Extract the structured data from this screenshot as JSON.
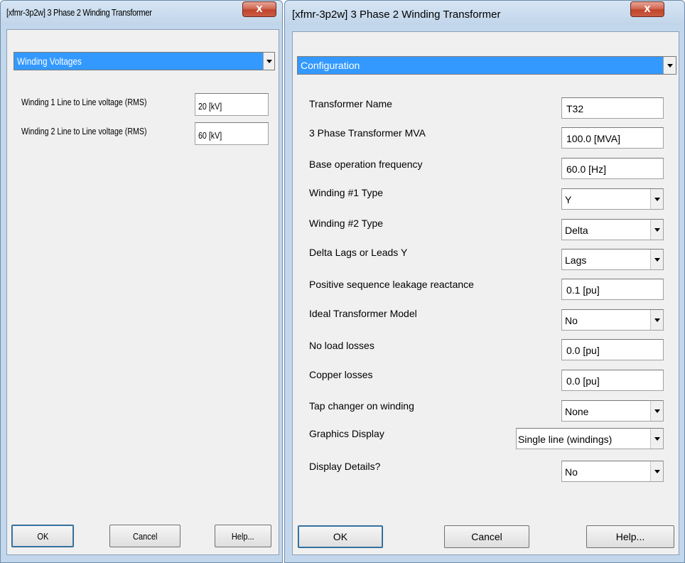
{
  "left_dialog": {
    "title": "[xfmr-3p2w] 3 Phase 2 Winding Transformer",
    "close_label": "X",
    "page_selector": "Winding Voltages",
    "params": [
      {
        "label": "Winding 1 Line to Line voltage (RMS)",
        "value": "20 [kV]"
      },
      {
        "label": "Winding 2 Line to Line voltage (RMS)",
        "value": "60 [kV]"
      }
    ],
    "buttons": {
      "ok": "OK",
      "cancel": "Cancel",
      "help": "Help..."
    }
  },
  "right_dialog": {
    "title": "[xfmr-3p2w] 3 Phase 2 Winding Transformer",
    "close_label": "X",
    "page_selector": "Configuration",
    "params": [
      {
        "label": "Transformer Name",
        "value": "T32",
        "kind": "text"
      },
      {
        "label": "3 Phase Transformer MVA",
        "value": "100.0 [MVA]",
        "kind": "text"
      },
      {
        "label": "Base operation frequency",
        "value": "60.0 [Hz]",
        "kind": "text"
      },
      {
        "label": "Winding #1 Type",
        "value": "Y",
        "kind": "combo"
      },
      {
        "label": "Winding #2 Type",
        "value": "Delta",
        "kind": "combo"
      },
      {
        "label": "Delta Lags or Leads Y",
        "value": "Lags",
        "kind": "combo"
      },
      {
        "label": "Positive sequence leakage reactance",
        "value": "0.1 [pu]",
        "kind": "text"
      },
      {
        "label": "Ideal Transformer Model",
        "value": "No",
        "kind": "combo"
      },
      {
        "label": "No load losses",
        "value": "0.0 [pu]",
        "kind": "text"
      },
      {
        "label": "Copper losses",
        "value": "0.0 [pu]",
        "kind": "text"
      },
      {
        "label": "Tap changer on winding",
        "value": "None",
        "kind": "combo"
      },
      {
        "label": "Graphics Display",
        "value": "Single line (windings)",
        "kind": "combo"
      },
      {
        "label": "Display Details?",
        "value": "No",
        "kind": "combo"
      }
    ],
    "buttons": {
      "ok": "OK",
      "cancel": "Cancel",
      "help": "Help..."
    }
  },
  "colors": {
    "selection_blue": "#3399ff",
    "frame_blue": "#c3d7ec",
    "close_red": "#c0452c"
  }
}
